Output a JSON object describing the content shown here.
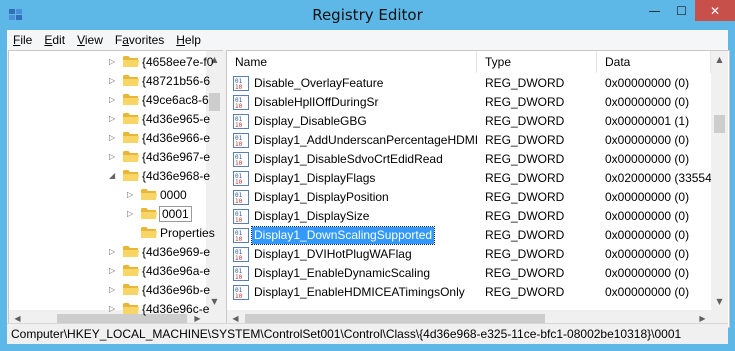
{
  "window": {
    "title": "Registry Editor",
    "accent": "#5db7e7",
    "close_color": "#c7504b"
  },
  "titlebar": {
    "min_glyph": "—",
    "max_glyph": "☐",
    "close_glyph": "✕"
  },
  "menu": [
    {
      "accel": "F",
      "rest": "ile"
    },
    {
      "accel": "E",
      "rest": "dit"
    },
    {
      "accel": "V",
      "rest": "iew"
    },
    {
      "accel": "",
      "pre": "F",
      "mid": "a",
      "rest": "vorites"
    },
    {
      "accel": "H",
      "rest": "elp"
    }
  ],
  "menu_labels": [
    "File",
    "Edit",
    "View",
    "Favorites",
    "Help"
  ],
  "tree": {
    "items": [
      {
        "label": "{4658ee7e-f0",
        "expander": "▷"
      },
      {
        "label": "{48721b56-6",
        "expander": "▷"
      },
      {
        "label": "{49ce6ac8-6",
        "expander": "▷"
      },
      {
        "label": "{4d36e965-e",
        "expander": "▷"
      },
      {
        "label": "{4d36e966-e",
        "expander": "▷"
      },
      {
        "label": "{4d36e967-e",
        "expander": "▷"
      },
      {
        "label": "{4d36e968-e",
        "expander": "◢"
      },
      {
        "label": "0000",
        "expander": "▷"
      },
      {
        "label": "0001",
        "expander": "▷"
      },
      {
        "label": "Properties",
        "expander": ""
      },
      {
        "label": "{4d36e969-e",
        "expander": "▷"
      },
      {
        "label": "{4d36e96a-e",
        "expander": "▷"
      },
      {
        "label": "{4d36e96b-e",
        "expander": "▷"
      },
      {
        "label": "{4d36e96c-e",
        "expander": "▷"
      }
    ]
  },
  "list": {
    "columns": [
      "Name",
      "Type",
      "Data"
    ],
    "rows": [
      {
        "name": "Disable_OverlayFeature",
        "type": "REG_DWORD",
        "data": "0x00000000 (0)"
      },
      {
        "name": "DisableHplIOffDuringSr",
        "type": "REG_DWORD",
        "data": "0x00000000 (0)"
      },
      {
        "name": "Display_DisableGBG",
        "type": "REG_DWORD",
        "data": "0x00000001 (1)"
      },
      {
        "name": "Display1_AddUnderscanPercentageHDMI",
        "type": "REG_DWORD",
        "data": "0x00000000 (0)"
      },
      {
        "name": "Display1_DisableSdvoCrtEdidRead",
        "type": "REG_DWORD",
        "data": "0x00000000 (0)"
      },
      {
        "name": "Display1_DisplayFlags",
        "type": "REG_DWORD",
        "data": "0x02000000 (335544"
      },
      {
        "name": "Display1_DisplayPosition",
        "type": "REG_DWORD",
        "data": "0x00000000 (0)"
      },
      {
        "name": "Display1_DisplaySize",
        "type": "REG_DWORD",
        "data": "0x00000000 (0)"
      },
      {
        "name": "Display1_DownScalingSupported",
        "type": "REG_DWORD",
        "data": "0x00000000 (0)"
      },
      {
        "name": "Display1_DVIHotPlugWAFlag",
        "type": "REG_DWORD",
        "data": "0x00000000 (0)"
      },
      {
        "name": "Display1_EnableDynamicScaling",
        "type": "REG_DWORD",
        "data": "0x00000000 (0)"
      },
      {
        "name": "Display1_EnableHDMICEATimingsOnly",
        "type": "REG_DWORD",
        "data": "0x00000000 (0)"
      }
    ],
    "selected_index": 8
  },
  "statusbar": {
    "path": "Computer\\HKEY_LOCAL_MACHINE\\SYSTEM\\ControlSet001\\Control\\Class\\{4d36e968-e325-11ce-bfc1-08002be10318}\\0001"
  }
}
